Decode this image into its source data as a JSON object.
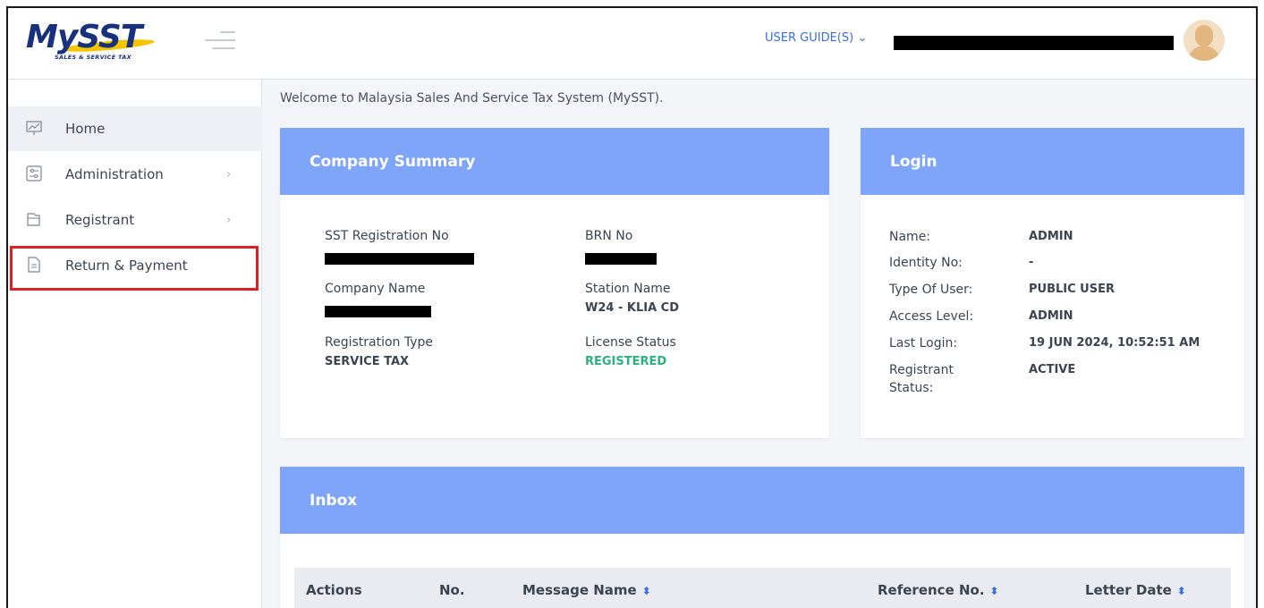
{
  "header": {
    "logo_text": "MySST",
    "logo_subtitle": "SALES & SERVICE TAX",
    "user_guide_label": "USER GUIDE(S)",
    "user_guide_chevron": "⌄"
  },
  "sidebar": {
    "items": [
      {
        "label": "Home",
        "icon": "chart-icon"
      },
      {
        "label": "Administration",
        "icon": "sliders-icon",
        "chevron": "›"
      },
      {
        "label": "Registrant",
        "icon": "folder-icon",
        "chevron": "›"
      },
      {
        "label": "Return & Payment",
        "icon": "document-icon"
      }
    ]
  },
  "welcome": "Welcome to Malaysia Sales And Service Tax System (MySST).",
  "company_summary": {
    "title": "Company Summary",
    "sst_reg_label": "SST Registration No",
    "brn_label": "BRN No",
    "company_name_label": "Company Name",
    "station_name_label": "Station Name",
    "station_name_value": "W24 - KLIA CD",
    "reg_type_label": "Registration Type",
    "reg_type_value": "SERVICE TAX",
    "license_status_label": "License Status",
    "license_status_value": "REGISTERED",
    "status_color": "#2bb37d"
  },
  "login": {
    "title": "Login",
    "rows": [
      {
        "label": "Name:",
        "value": "ADMIN"
      },
      {
        "label": "Identity No:",
        "value": "-"
      },
      {
        "label": "Type Of User:",
        "value": "PUBLIC USER"
      },
      {
        "label": "Access Level:",
        "value": "ADMIN"
      },
      {
        "label": "Last Login:",
        "value": "19 JUN 2024, 10:52:51 AM"
      },
      {
        "label": "Registrant Status:",
        "value": "ACTIVE"
      }
    ]
  },
  "inbox": {
    "title": "Inbox",
    "columns": [
      "Actions",
      "No.",
      "Message Name",
      "Reference No.",
      "Letter Date"
    ],
    "sort_icon": "⬍"
  },
  "colors": {
    "card_header": "#7ea5fa",
    "link_blue": "#3b6de0",
    "highlight_red": "#e02020"
  }
}
